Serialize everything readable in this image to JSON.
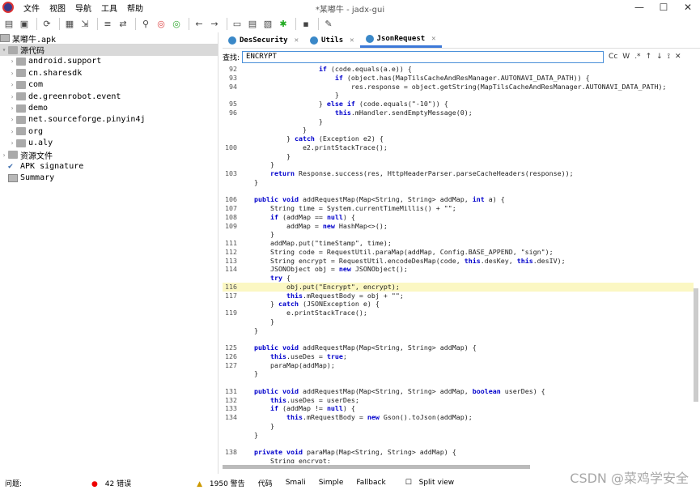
{
  "window": {
    "title": "*某嘟牛 - jadx-gui"
  },
  "menu": [
    "文件",
    "视图",
    "导航",
    "工具",
    "帮助"
  ],
  "toolbar": [
    "open",
    "save",
    "refresh",
    "save-all",
    "export",
    "expand",
    "sync",
    "search",
    "search-class",
    "search-usage",
    "back",
    "forward",
    "tree",
    "decompile",
    "recent",
    "debug",
    "log",
    "settings"
  ],
  "tree": {
    "root": "某嘟牛.apk",
    "source": "源代码",
    "packages": [
      "android.support",
      "cn.sharesdk",
      "com",
      "de.greenrobot.event",
      "demo",
      "net.sourceforge.pinyin4j",
      "org",
      "u.aly"
    ],
    "resources": "资源文件",
    "apk_sig": "APK signature",
    "summary": "Summary"
  },
  "tabs": [
    {
      "label": "DesSecurity"
    },
    {
      "label": "Utils"
    },
    {
      "label": "JsonRequest"
    }
  ],
  "search": {
    "label": "查找:",
    "value": "ENCRYPT",
    "cc": "Cc",
    "w": "W",
    "regex": ".*"
  },
  "code": [
    {
      "n": "92",
      "t": "                if (code.equals(a.e)) {"
    },
    {
      "n": "93",
      "t": "                    if (object.has(MapTilsCacheAndResManager.AUTONAVI_DATA_PATH)) {"
    },
    {
      "n": "94",
      "t": "                        res.response = object.getString(MapTilsCacheAndResManager.AUTONAVI_DATA_PATH);"
    },
    {
      "n": "",
      "t": "                    }"
    },
    {
      "n": "95",
      "t": "                } else if (code.equals(\"-10\")) {"
    },
    {
      "n": "96",
      "t": "                    this.mHandler.sendEmptyMessage(0);"
    },
    {
      "n": "",
      "t": "                }"
    },
    {
      "n": "",
      "t": "            }"
    },
    {
      "n": "",
      "t": "        } catch (Exception e2) {"
    },
    {
      "n": "100",
      "t": "            e2.printStackTrace();"
    },
    {
      "n": "",
      "t": "        }"
    },
    {
      "n": "",
      "t": "    }"
    },
    {
      "n": "103",
      "t": "    return Response.success(res, HttpHeaderParser.parseCacheHeaders(response));"
    },
    {
      "n": "",
      "t": "}"
    },
    {
      "n": "",
      "t": ""
    },
    {
      "n": "106",
      "t": "public void addRequestMap(Map<String, String> addMap, int a) {"
    },
    {
      "n": "107",
      "t": "    String time = System.currentTimeMillis() + \"\";"
    },
    {
      "n": "108",
      "t": "    if (addMap == null) {"
    },
    {
      "n": "109",
      "t": "        addMap = new HashMap<>();"
    },
    {
      "n": "",
      "t": "    }"
    },
    {
      "n": "111",
      "t": "    addMap.put(\"timeStamp\", time);"
    },
    {
      "n": "112",
      "t": "    String code = RequestUtil.paraMap(addMap, Config.BASE_APPEND, \"sign\");"
    },
    {
      "n": "113",
      "t": "    String encrypt = RequestUtil.encodeDesMap(code, this.desKey, this.desIV);"
    },
    {
      "n": "114",
      "t": "    JSONObject obj = new JSONObject();"
    },
    {
      "n": "",
      "t": "    try {"
    },
    {
      "n": "116",
      "t": "        obj.put(\"Encrypt\", encrypt);",
      "hl": true
    },
    {
      "n": "117",
      "t": "        this.mRequestBody = obj + \"\";"
    },
    {
      "n": "",
      "t": "    } catch (JSONException e) {"
    },
    {
      "n": "119",
      "t": "        e.printStackTrace();"
    },
    {
      "n": "",
      "t": "    }"
    },
    {
      "n": "",
      "t": "}"
    },
    {
      "n": "",
      "t": ""
    },
    {
      "n": "125",
      "t": "public void addRequestMap(Map<String, String> addMap) {"
    },
    {
      "n": "126",
      "t": "    this.useDes = true;"
    },
    {
      "n": "127",
      "t": "    paraMap(addMap);"
    },
    {
      "n": "",
      "t": "}"
    },
    {
      "n": "",
      "t": ""
    },
    {
      "n": "131",
      "t": "public void addRequestMap(Map<String, String> addMap, boolean userDes) {"
    },
    {
      "n": "132",
      "t": "    this.useDes = userDes;"
    },
    {
      "n": "133",
      "t": "    if (addMap != null) {"
    },
    {
      "n": "134",
      "t": "        this.mRequestBody = new Gson().toJson(addMap);"
    },
    {
      "n": "",
      "t": "    }"
    },
    {
      "n": "",
      "t": "}"
    },
    {
      "n": "",
      "t": ""
    },
    {
      "n": "138",
      "t": "private void paraMap(Map<String, String> addMap) {"
    },
    {
      "n": "",
      "t": "    String encrypt;"
    }
  ],
  "status": {
    "label": "问题:",
    "errors": "42 错误",
    "warnings": "1950 警告",
    "tabs": [
      "代码",
      "Smali",
      "Simple",
      "Fallback"
    ],
    "split": "Split view"
  },
  "watermark": "CSDN @菜鸡学安全"
}
